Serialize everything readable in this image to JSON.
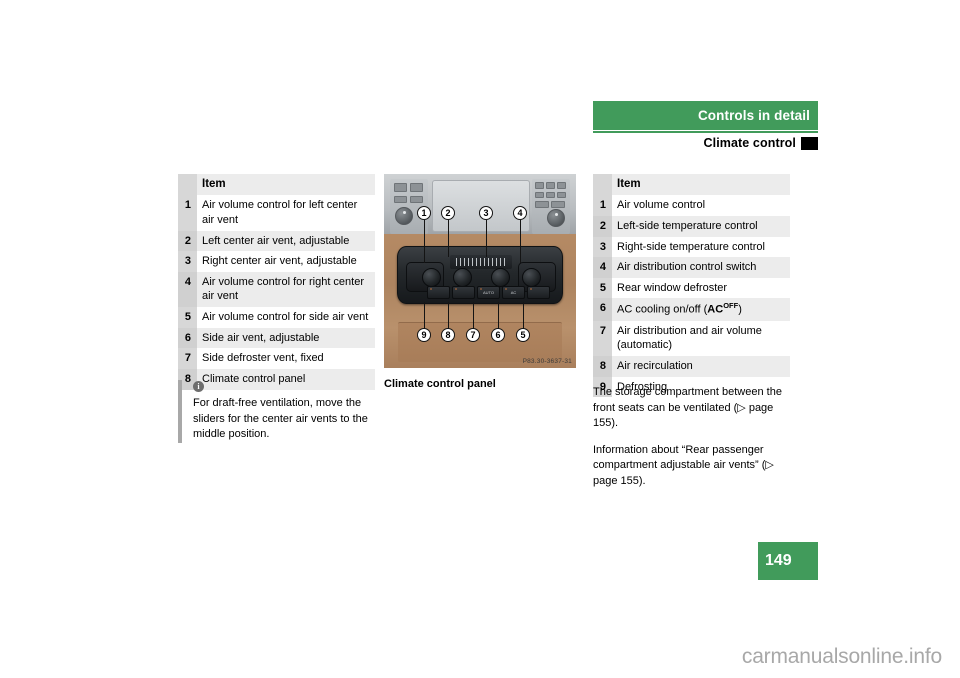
{
  "header": {
    "section_title": "Controls in detail",
    "subsection_title": "Climate control"
  },
  "left_table": {
    "header_label": "Item",
    "rows": [
      {
        "num": "1",
        "label": "Air volume control for left center air vent"
      },
      {
        "num": "2",
        "label": "Left center air vent, adjustable"
      },
      {
        "num": "3",
        "label": "Right center air vent, adjustable"
      },
      {
        "num": "4",
        "label": "Air volume control for right center air vent"
      },
      {
        "num": "5",
        "label": "Air volume control for side air vent"
      },
      {
        "num": "6",
        "label": "Side air vent, adjustable"
      },
      {
        "num": "7",
        "label": "Side defroster vent, fixed"
      },
      {
        "num": "8",
        "label": "Climate control panel"
      }
    ]
  },
  "right_table": {
    "header_label": "Item",
    "rows": [
      {
        "num": "1",
        "label": "Air volume control"
      },
      {
        "num": "2",
        "label": "Left-side temperature control"
      },
      {
        "num": "3",
        "label": "Right-side temperature control"
      },
      {
        "num": "4",
        "label": "Air distribution control switch"
      },
      {
        "num": "5",
        "label": "Rear window defroster"
      },
      {
        "num": "6",
        "label": "AC cooling on/off (AC OFF)",
        "label_prefix": "AC cooling on/off (",
        "label_bold": "AC",
        "label_sup": "OFF",
        "label_suffix": ")"
      },
      {
        "num": "7",
        "label": "Air distribution and air volume (automatic)"
      },
      {
        "num": "8",
        "label": "Air recirculation"
      },
      {
        "num": "9",
        "label": "Defrosting"
      }
    ]
  },
  "figure": {
    "caption": "Climate control panel",
    "image_code": "P83.30-3637-31",
    "callouts_top": [
      "1",
      "2",
      "3",
      "4"
    ],
    "callouts_bottom": [
      "9",
      "8",
      "7",
      "6",
      "5"
    ],
    "panel_buttons": [
      "",
      "",
      "AUTO",
      "AC",
      ""
    ]
  },
  "note": {
    "icon": "info-icon",
    "text": "For draft-free ventilation, move the sliders for the center air vents to the middle position."
  },
  "right_paragraphs": {
    "para1": "The storage compartment between the front seats can be ventilated (▷ page 155).",
    "para2": "Information about “Rear passenger compartment adjustable air vents” (▷ page 155)."
  },
  "page_number": "149",
  "watermark": "carmanualsonline.info",
  "colors": {
    "brand_green": "#419b5b",
    "table_header_gray": "#ececec",
    "table_num_gray": "#d7d7d7"
  }
}
